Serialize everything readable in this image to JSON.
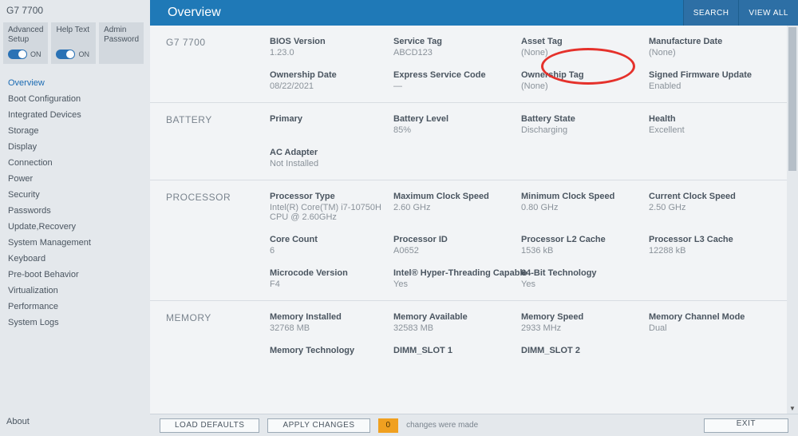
{
  "model": "G7 7700",
  "toggles": [
    {
      "label": "Advanced Setup",
      "state": "ON"
    },
    {
      "label": "Help Text",
      "state": "ON"
    },
    {
      "label": "Admin Password",
      "state": ""
    }
  ],
  "nav": [
    "Overview",
    "Boot Configuration",
    "Integrated Devices",
    "Storage",
    "Display",
    "Connection",
    "Power",
    "Security",
    "Passwords",
    "Update,Recovery",
    "System Management",
    "Keyboard",
    "Pre-boot Behavior",
    "Virtualization",
    "Performance",
    "System Logs"
  ],
  "about": "About",
  "header": {
    "title": "Overview",
    "search": "SEARCH",
    "viewall": "VIEW ALL"
  },
  "sections": {
    "general": {
      "label": "G7 7700",
      "fields": [
        {
          "lbl": "BIOS Version",
          "val": "1.23.0"
        },
        {
          "lbl": "Service Tag",
          "val": "ABCD123"
        },
        {
          "lbl": "Asset Tag",
          "val": "(None)"
        },
        {
          "lbl": "Manufacture Date",
          "val": "(None)"
        },
        {
          "lbl": "Ownership Date",
          "val": "08/22/2021"
        },
        {
          "lbl": "Express Service Code",
          "val": "—"
        },
        {
          "lbl": "Ownership Tag",
          "val": "(None)"
        },
        {
          "lbl": "Signed Firmware Update",
          "val": "Enabled"
        }
      ]
    },
    "battery": {
      "label": "BATTERY",
      "fields": [
        {
          "lbl": "Primary",
          "val": ""
        },
        {
          "lbl": "Battery Level",
          "val": "85%"
        },
        {
          "lbl": "Battery State",
          "val": "Discharging"
        },
        {
          "lbl": "Health",
          "val": "Excellent"
        },
        {
          "lbl": "AC Adapter",
          "val": "Not Installed"
        }
      ]
    },
    "processor": {
      "label": "PROCESSOR",
      "fields": [
        {
          "lbl": "Processor Type",
          "val": "Intel(R) Core(TM) i7-10750H CPU @ 2.60GHz"
        },
        {
          "lbl": "Maximum Clock Speed",
          "val": "2.60 GHz"
        },
        {
          "lbl": "Minimum Clock Speed",
          "val": "0.80 GHz"
        },
        {
          "lbl": "Current Clock Speed",
          "val": "2.50 GHz"
        },
        {
          "lbl": "Core Count",
          "val": "6"
        },
        {
          "lbl": "Processor ID",
          "val": "A0652"
        },
        {
          "lbl": "Processor L2 Cache",
          "val": "1536 kB"
        },
        {
          "lbl": "Processor L3 Cache",
          "val": "12288 kB"
        },
        {
          "lbl": "Microcode Version",
          "val": "F4"
        },
        {
          "lbl": "Intel® Hyper-Threading Capable",
          "val": "Yes"
        },
        {
          "lbl": "64-Bit Technology",
          "val": "Yes"
        }
      ]
    },
    "memory": {
      "label": "MEMORY",
      "fields": [
        {
          "lbl": "Memory Installed",
          "val": "32768 MB"
        },
        {
          "lbl": "Memory Available",
          "val": "32583 MB"
        },
        {
          "lbl": "Memory Speed",
          "val": "2933 MHz"
        },
        {
          "lbl": "Memory Channel Mode",
          "val": "Dual"
        },
        {
          "lbl": "Memory Technology",
          "val": ""
        },
        {
          "lbl": "DIMM_SLOT 1",
          "val": ""
        },
        {
          "lbl": "DIMM_SLOT 2",
          "val": ""
        }
      ]
    }
  },
  "footer": {
    "load": "LOAD DEFAULTS",
    "apply": "APPLY CHANGES",
    "count": "0",
    "text": "changes were made",
    "exit": "EXIT"
  }
}
